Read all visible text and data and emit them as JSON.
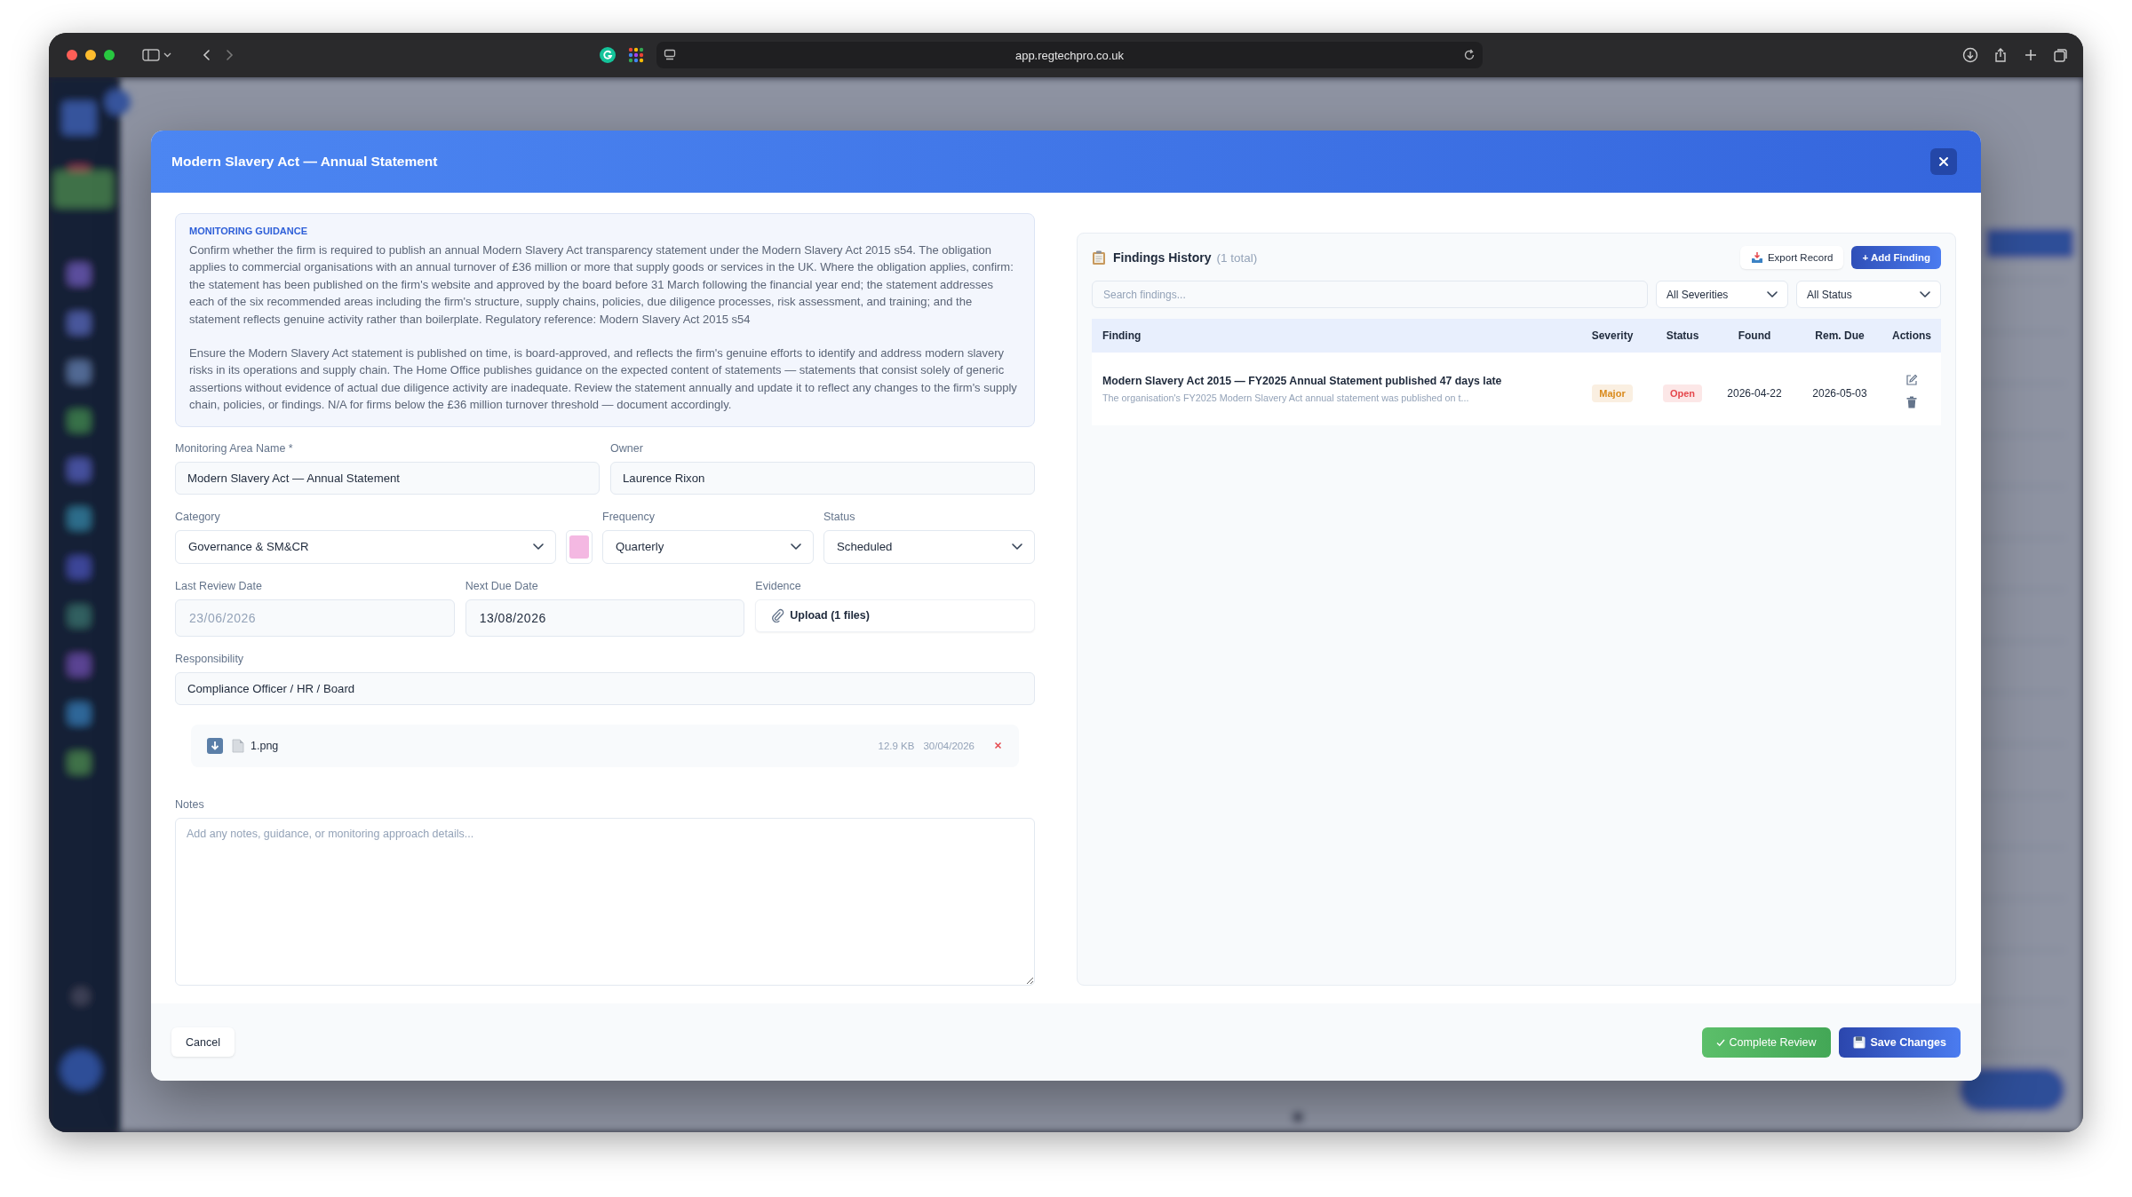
{
  "browser": {
    "url": "app.regtechpro.co.uk"
  },
  "modal": {
    "title": "Modern Slavery Act — Annual Statement"
  },
  "guidance": {
    "heading": "MONITORING GUIDANCE",
    "paragraphs": [
      "Confirm whether the firm is required to publish an annual Modern Slavery Act transparency statement under the Modern Slavery Act 2015 s54. The obligation applies to commercial organisations with an annual turnover of £36 million or more that supply goods or services in the UK. Where the obligation applies, confirm: the statement has been published on the firm's website and approved by the board before 31 March following the financial year end; the statement addresses each of the six recommended areas including the firm's structure, supply chains, policies, due diligence processes, risk assessment, and training; and the statement reflects genuine activity rather than boilerplate. Regulatory reference: Modern Slavery Act 2015 s54",
      "Ensure the Modern Slavery Act statement is published on time, is board-approved, and reflects the firm's genuine efforts to identify and address modern slavery risks in its operations and supply chain. The Home Office publishes guidance on the expected content of statements — statements that consist solely of generic assertions without evidence of actual due diligence activity are inadequate. Review the statement annually and update it to reflect any changes to the firm's supply chain, policies, or findings. N/A for firms below the £36 million turnover threshold — document accordingly."
    ]
  },
  "form": {
    "name": {
      "label": "Monitoring Area Name *",
      "value": "Modern Slavery Act — Annual Statement"
    },
    "owner": {
      "label": "Owner",
      "value": "Laurence Rixon"
    },
    "category": {
      "label": "Category",
      "value": "Governance & SM&CR",
      "color": "#f4b8e2"
    },
    "frequency": {
      "label": "Frequency",
      "value": "Quarterly"
    },
    "status": {
      "label": "Status",
      "value": "Scheduled"
    },
    "last_review_date": {
      "label": "Last Review Date",
      "value": "23/06/2026",
      "disabled": true
    },
    "next_due_date": {
      "label": "Next Due Date",
      "value": "13/08/2026",
      "disabled": false
    },
    "evidence": {
      "label": "Evidence",
      "button": "Upload (1 files)"
    },
    "responsibility": {
      "label": "Responsibility",
      "value": "Compliance Officer / HR / Board"
    },
    "attachments": [
      {
        "name": "1.png",
        "size": "12.9 KB",
        "date": "30/04/2026"
      }
    ],
    "notes": {
      "label": "Notes",
      "placeholder": "Add any notes, guidance, or monitoring approach details..."
    }
  },
  "findings": {
    "title": "Findings History",
    "count": "(1 total)",
    "export_button": "Export Record",
    "add_button": "+ Add Finding",
    "search": {
      "placeholder": "Search findings..."
    },
    "filters": [
      "All Severities",
      "All Status"
    ],
    "columns": [
      "Finding",
      "Severity",
      "Status",
      "Found",
      "Rem. Due",
      "Actions"
    ],
    "rows": [
      {
        "title": "Modern Slavery Act 2015 — FY2025 Annual Statement published 47 days late",
        "summary": "The organisation's FY2025 Modern Slavery Act annual statement was published on t...",
        "severity": {
          "text": "Major",
          "color": "#d98a1c"
        },
        "status": {
          "text": "Open",
          "color": "#e5484d"
        },
        "found": "2026-04-22",
        "rem_due": "2026-05-03"
      }
    ]
  },
  "footer": {
    "cancel": "Cancel",
    "complete": "Complete Review",
    "save": "Save Changes"
  }
}
